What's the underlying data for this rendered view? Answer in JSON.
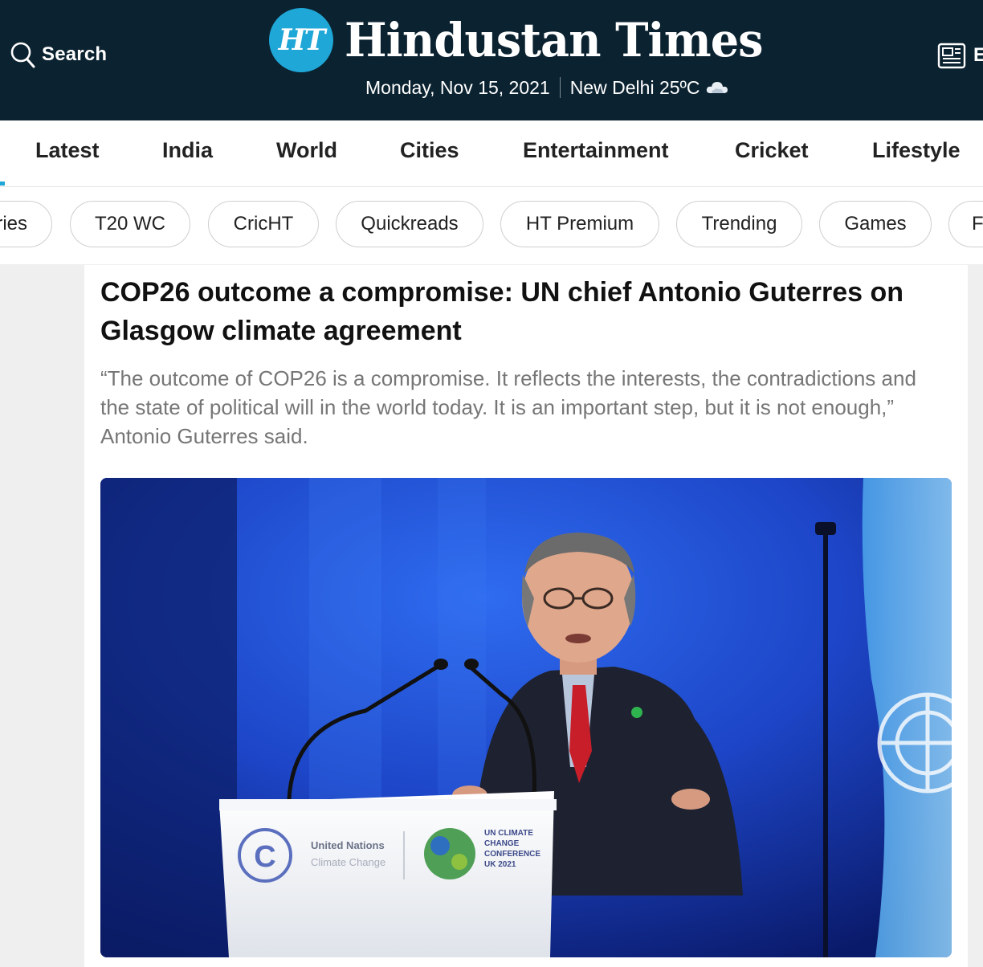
{
  "header": {
    "search_label": "Search",
    "logo_badge": "HT",
    "logo_text": "Hindustan Times",
    "date": "Monday, Nov 15, 2021",
    "city_weather": "New Delhi 25ºC",
    "weather_icon": "cloud-icon",
    "epaper_label": "E",
    "epaper_icon": "newspaper-icon"
  },
  "nav": {
    "items": [
      "Latest",
      "India",
      "World",
      "Cities",
      "Entertainment",
      "Cricket",
      "Lifestyle"
    ],
    "accent_color": "#1fa7d7"
  },
  "pills": [
    "ries",
    "T20 WC",
    "CricHT",
    "Quickreads",
    "HT Premium",
    "Trending",
    "Games",
    "F"
  ],
  "article": {
    "headline": "COP26 outcome a compromise: UN chief Antonio Guterres on Glasgow climate agreement",
    "summary": "“The outcome of COP26 is a compromise. It reflects the interests, the contradictions and the state of political will in the world today. It is an important step, but it is not enough,” Antonio Guterres said.",
    "image": {
      "podium_org": "United Nations",
      "podium_org_sub": "Climate Change",
      "podium_conf": [
        "UN CLIMATE",
        "CHANGE",
        "CONFERENCE",
        "UK 2021"
      ]
    }
  },
  "colors": {
    "header_bg": "#0b2230",
    "brand_blue": "#1fa7d7",
    "page_bg": "#efefef"
  }
}
